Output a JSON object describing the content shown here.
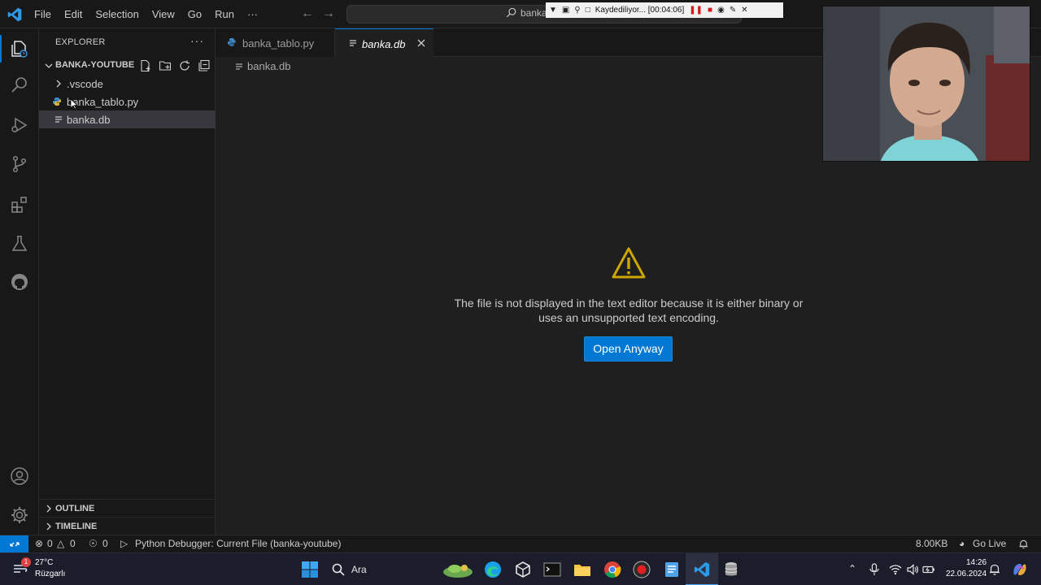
{
  "menu": [
    "File",
    "Edit",
    "Selection",
    "View",
    "Go",
    "Run",
    "···"
  ],
  "command_center": {
    "text": "banka"
  },
  "recorder": {
    "status": "Kaydediliyor... [00:04:06]"
  },
  "explorer": {
    "title": "EXPLORER",
    "more": "···",
    "folder": "BANKA-YOUTUBE",
    "items": [
      {
        "label": ".vscode",
        "kind": "folder"
      },
      {
        "label": "banka_tablo.py",
        "kind": "python"
      },
      {
        "label": "banka.db",
        "kind": "file",
        "selected": true
      }
    ],
    "sections": [
      "OUTLINE",
      "TIMELINE"
    ]
  },
  "tabs": [
    {
      "label": "banka_tablo.py",
      "active": false
    },
    {
      "label": "banka.db",
      "active": true
    }
  ],
  "breadcrumb": "banka.db",
  "editor": {
    "message_line1": "The file is not displayed in the text editor because it is either binary or",
    "message_line2": "uses an unsupported text encoding.",
    "button": "Open Anyway"
  },
  "statusbar": {
    "errors": "0",
    "warnings": "0",
    "ports": "0",
    "debugger": "Python Debugger: Current File (banka-youtube)",
    "filesize": "8.00KB",
    "golive": "Go Live"
  },
  "taskbar": {
    "weather_temp": "27°C",
    "weather_desc": "Rüzgarlı",
    "weather_badge": "1",
    "search_label": "Ara",
    "time": "14:26",
    "date": "22.06.2024"
  },
  "colors": {
    "accent": "#0078d4",
    "warning": "#cca700",
    "python": "#3c8dcf"
  }
}
